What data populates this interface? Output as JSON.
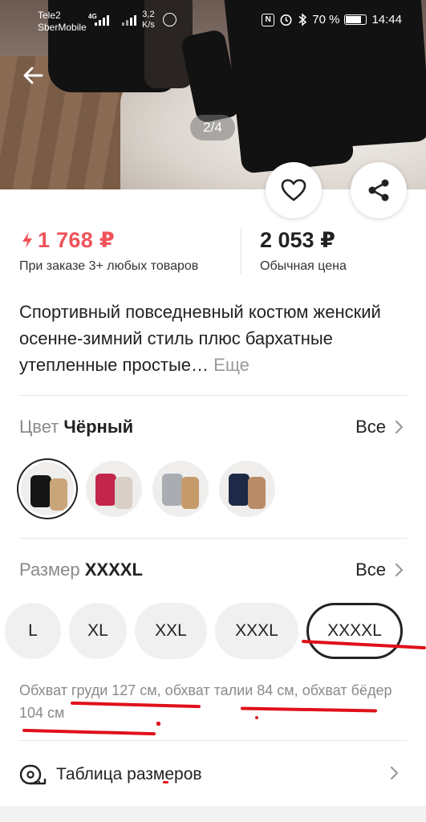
{
  "status_bar": {
    "carrier_1": "Tele2",
    "carrier_2": "SberMobile",
    "network": "4G",
    "speed_value": "3,2",
    "speed_unit": "K/s",
    "battery": "70 %",
    "time": "14:44"
  },
  "gallery": {
    "counter": "2/4"
  },
  "price": {
    "sale_price": "1 768 ₽",
    "sale_note": "При заказе 3+ любых товаров",
    "regular_price": "2 053 ₽",
    "regular_note": "Обычная цена",
    "sale_color": "#f0535a"
  },
  "product": {
    "title": "Спортивный повседневный костюм женский осенне-зимний стиль плюс бархатные утепленные простые…",
    "more_label": "Еще"
  },
  "color": {
    "label": "Цвет",
    "selected": "Чёрный",
    "all_label": "Все",
    "swatches": [
      {
        "name": "black",
        "a": "#151515",
        "b": "#c9a57a",
        "selected": true
      },
      {
        "name": "crimson",
        "a": "#c2264a",
        "b": "#d8cfc6",
        "selected": false
      },
      {
        "name": "grey",
        "a": "#a9adb2",
        "b": "#c49a6a",
        "selected": false
      },
      {
        "name": "navy",
        "a": "#1e2947",
        "b": "#b88c66",
        "selected": false
      }
    ]
  },
  "size": {
    "label": "Размер",
    "selected": "XXXXL",
    "all_label": "Все",
    "options": [
      "L",
      "XL",
      "XXL",
      "XXXL",
      "XXXXL"
    ],
    "description": "Обхват груди 127 см, обхват талии 84 см, обхват бёдер 104 см"
  },
  "size_table": {
    "label": "Таблица размеров"
  },
  "icons": {
    "back": "arrow-left-icon",
    "favorite": "heart-icon",
    "share": "share-icon",
    "chevron": "chevron-right-icon",
    "tape": "measuring-tape-icon",
    "sale": "lightning-icon"
  }
}
